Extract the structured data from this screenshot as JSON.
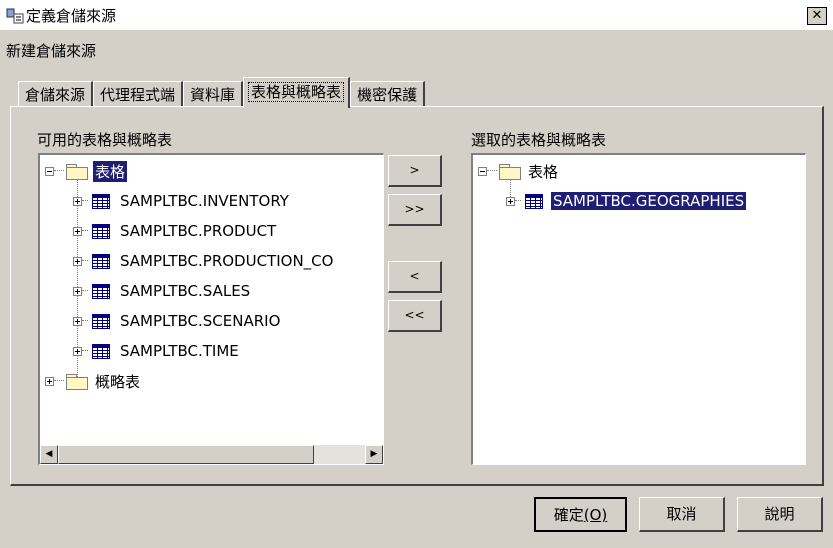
{
  "window": {
    "title": "定義倉儲來源",
    "close_label": "✕",
    "subtitle": "新建倉儲來源"
  },
  "tabs": [
    {
      "label": "倉儲來源",
      "active": false
    },
    {
      "label": "代理程式端",
      "active": false
    },
    {
      "label": "資料庫",
      "active": false
    },
    {
      "label": "表格與概略表",
      "active": true
    },
    {
      "label": "機密保護",
      "active": false
    }
  ],
  "available": {
    "label": "可用的表格與概略表",
    "tables_folder": "表格",
    "items": [
      "SAMPLTBC.INVENTORY",
      "SAMPLTBC.PRODUCT",
      "SAMPLTBC.PRODUCTION_CO",
      "SAMPLTBC.SALES",
      "SAMPLTBC.SCENARIO",
      "SAMPLTBC.TIME"
    ],
    "views_folder": "概略表"
  },
  "selected": {
    "label": "選取的表格與概略表",
    "tables_folder": "表格",
    "items": [
      "SAMPLTBC.GEOGRAPHIES"
    ]
  },
  "transfer_buttons": {
    "add": ">",
    "add_all": ">>",
    "remove": "<",
    "remove_all": "<<"
  },
  "buttons": {
    "ok": "確定",
    "ok_mnemonic": "(O)",
    "cancel": "取消",
    "help": "說明"
  },
  "icons": {
    "app": "window-app-icon",
    "folder": "folder-icon",
    "table": "table-icon",
    "expand": "plus-expander-icon",
    "collapse": "minus-expander-icon"
  },
  "colors": {
    "dialog_bg": "#d4d0c8",
    "selection_bg": "#1e1e74",
    "selection_fg": "#ffffff"
  }
}
